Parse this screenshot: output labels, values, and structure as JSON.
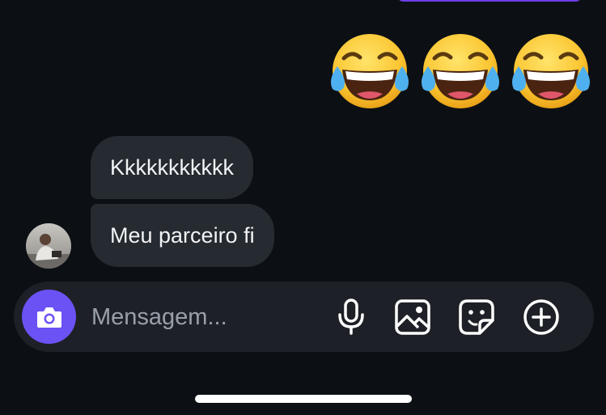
{
  "conversation": {
    "sent_emojis": [
      {
        "icon": "face-with-tears-of-joy-icon"
      },
      {
        "icon": "face-with-tears-of-joy-icon"
      },
      {
        "icon": "face-with-tears-of-joy-icon"
      }
    ],
    "received_messages": [
      {
        "text": "Kkkkkkkkkkk"
      },
      {
        "text": "Meu parceiro fi"
      }
    ],
    "sender_avatar": {
      "icon": "user-avatar-photo"
    }
  },
  "composer": {
    "placeholder": "Mensagem...",
    "value": "",
    "camera_icon": "camera-icon",
    "tools": [
      "microphone-icon",
      "image-icon",
      "sticker-icon",
      "plus-circle-icon"
    ]
  },
  "colors": {
    "background": "#0c1014",
    "received_bubble": "#262a31",
    "composer": "#1d2127",
    "accent": "#6b52f5",
    "sent_bubble": "#6c3fe6"
  }
}
